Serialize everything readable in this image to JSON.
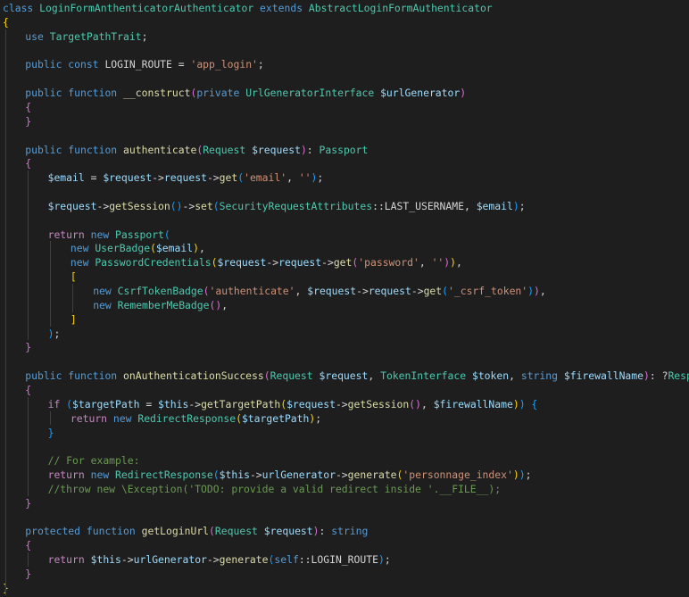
{
  "code": {
    "colors": {
      "background": "#1e1e1e",
      "keyword": "#569cd6",
      "control": "#c586c0",
      "function": "#dcdcaa",
      "class": "#4ec9b0",
      "variable": "#9cdcfe",
      "string": "#ce9178",
      "comment": "#6a9955",
      "plain": "#d4d4d4",
      "bracket_1": "#ffd700",
      "bracket_2": "#da70d6",
      "bracket_3": "#179fff"
    },
    "lines": [
      {
        "indent": 0,
        "tokens": [
          [
            "kw",
            "class "
          ],
          [
            "cls",
            "LoginFormAnthenticatorAuthenticator"
          ],
          [
            "pl",
            " "
          ],
          [
            "kw",
            "extends "
          ],
          [
            "cls",
            "AbstractLoginFormAuthenticator"
          ]
        ]
      },
      {
        "indent": 0,
        "tokens": [
          [
            "b1",
            "{"
          ]
        ]
      },
      {
        "indent": 1,
        "tokens": [
          [
            "kw",
            "use "
          ],
          [
            "cls",
            "TargetPathTrait"
          ],
          [
            "pl",
            ";"
          ]
        ]
      },
      {
        "indent": 0,
        "tokens": []
      },
      {
        "indent": 1,
        "tokens": [
          [
            "kw",
            "public const "
          ],
          [
            "pl",
            "LOGIN_ROUTE = "
          ],
          [
            "str",
            "'app_login'"
          ],
          [
            "pl",
            ";"
          ]
        ]
      },
      {
        "indent": 0,
        "tokens": []
      },
      {
        "indent": 1,
        "tokens": [
          [
            "kw",
            "public function "
          ],
          [
            "fn",
            "__construct"
          ],
          [
            "b2",
            "("
          ],
          [
            "kw",
            "private "
          ],
          [
            "cls",
            "UrlGeneratorInterface "
          ],
          [
            "var",
            "$urlGenerator"
          ],
          [
            "b2",
            ")"
          ]
        ]
      },
      {
        "indent": 1,
        "tokens": [
          [
            "b2",
            "{"
          ]
        ]
      },
      {
        "indent": 1,
        "tokens": [
          [
            "b2",
            "}"
          ]
        ]
      },
      {
        "indent": 0,
        "tokens": []
      },
      {
        "indent": 1,
        "tokens": [
          [
            "kw",
            "public function "
          ],
          [
            "fn",
            "authenticate"
          ],
          [
            "b2",
            "("
          ],
          [
            "cls",
            "Request "
          ],
          [
            "var",
            "$request"
          ],
          [
            "b2",
            ")"
          ],
          [
            "pl",
            ": "
          ],
          [
            "cls",
            "Passport"
          ]
        ]
      },
      {
        "indent": 1,
        "tokens": [
          [
            "b2",
            "{"
          ]
        ]
      },
      {
        "indent": 2,
        "tokens": [
          [
            "var",
            "$email"
          ],
          [
            "pl",
            " = "
          ],
          [
            "var",
            "$request"
          ],
          [
            "pl",
            "->"
          ],
          [
            "var",
            "request"
          ],
          [
            "pl",
            "->"
          ],
          [
            "fn",
            "get"
          ],
          [
            "b3",
            "("
          ],
          [
            "str",
            "'email'"
          ],
          [
            "pl",
            ", "
          ],
          [
            "str",
            "''"
          ],
          [
            "b3",
            ")"
          ],
          [
            "pl",
            ";"
          ]
        ]
      },
      {
        "indent": 0,
        "tokens": []
      },
      {
        "indent": 2,
        "tokens": [
          [
            "var",
            "$request"
          ],
          [
            "pl",
            "->"
          ],
          [
            "fn",
            "getSession"
          ],
          [
            "b3",
            "()"
          ],
          [
            "pl",
            "->"
          ],
          [
            "fn",
            "set"
          ],
          [
            "b3",
            "("
          ],
          [
            "cls",
            "SecurityRequestAttributes"
          ],
          [
            "pl",
            "::LAST_USERNAME, "
          ],
          [
            "var",
            "$email"
          ],
          [
            "b3",
            ")"
          ],
          [
            "pl",
            ";"
          ]
        ]
      },
      {
        "indent": 0,
        "tokens": []
      },
      {
        "indent": 2,
        "tokens": [
          [
            "ctrl",
            "return "
          ],
          [
            "kw",
            "new "
          ],
          [
            "cls",
            "Passport"
          ],
          [
            "b3",
            "("
          ]
        ]
      },
      {
        "indent": 3,
        "tokens": [
          [
            "kw",
            "new "
          ],
          [
            "cls",
            "UserBadge"
          ],
          [
            "b1",
            "("
          ],
          [
            "var",
            "$email"
          ],
          [
            "b1",
            ")"
          ],
          [
            "pl",
            ","
          ]
        ]
      },
      {
        "indent": 3,
        "tokens": [
          [
            "kw",
            "new "
          ],
          [
            "cls",
            "PasswordCredentials"
          ],
          [
            "b1",
            "("
          ],
          [
            "var",
            "$request"
          ],
          [
            "pl",
            "->"
          ],
          [
            "var",
            "request"
          ],
          [
            "pl",
            "->"
          ],
          [
            "fn",
            "get"
          ],
          [
            "b2",
            "("
          ],
          [
            "str",
            "'password'"
          ],
          [
            "pl",
            ", "
          ],
          [
            "str",
            "''"
          ],
          [
            "b2",
            ")"
          ],
          [
            "b1",
            ")"
          ],
          [
            "pl",
            ","
          ]
        ]
      },
      {
        "indent": 3,
        "tokens": [
          [
            "b1",
            "["
          ]
        ]
      },
      {
        "indent": 4,
        "tokens": [
          [
            "kw",
            "new "
          ],
          [
            "cls",
            "CsrfTokenBadge"
          ],
          [
            "b2",
            "("
          ],
          [
            "str",
            "'authenticate'"
          ],
          [
            "pl",
            ", "
          ],
          [
            "var",
            "$request"
          ],
          [
            "pl",
            "->"
          ],
          [
            "var",
            "request"
          ],
          [
            "pl",
            "->"
          ],
          [
            "fn",
            "get"
          ],
          [
            "b3",
            "("
          ],
          [
            "str",
            "'_csrf_token'"
          ],
          [
            "b3",
            ")"
          ],
          [
            "b2",
            ")"
          ],
          [
            "pl",
            ","
          ]
        ]
      },
      {
        "indent": 4,
        "tokens": [
          [
            "kw",
            "new "
          ],
          [
            "cls",
            "RememberMeBadge"
          ],
          [
            "b2",
            "()"
          ],
          [
            "pl",
            ","
          ]
        ]
      },
      {
        "indent": 3,
        "tokens": [
          [
            "b1",
            "]"
          ]
        ]
      },
      {
        "indent": 2,
        "tokens": [
          [
            "b3",
            ")"
          ],
          [
            "pl",
            ";"
          ]
        ]
      },
      {
        "indent": 1,
        "tokens": [
          [
            "b2",
            "}"
          ]
        ]
      },
      {
        "indent": 0,
        "tokens": []
      },
      {
        "indent": 1,
        "tokens": [
          [
            "kw",
            "public function "
          ],
          [
            "fn",
            "onAuthenticationSuccess"
          ],
          [
            "b2",
            "("
          ],
          [
            "cls",
            "Request "
          ],
          [
            "var",
            "$request"
          ],
          [
            "pl",
            ", "
          ],
          [
            "cls",
            "TokenInterface "
          ],
          [
            "var",
            "$token"
          ],
          [
            "pl",
            ", "
          ],
          [
            "kw",
            "string "
          ],
          [
            "var",
            "$firewallName"
          ],
          [
            "b2",
            ")"
          ],
          [
            "pl",
            ": ?"
          ],
          [
            "cls",
            "Response"
          ]
        ]
      },
      {
        "indent": 1,
        "tokens": [
          [
            "b2",
            "{"
          ]
        ]
      },
      {
        "indent": 2,
        "tokens": [
          [
            "ctrl",
            "if "
          ],
          [
            "b3",
            "("
          ],
          [
            "var",
            "$targetPath"
          ],
          [
            "pl",
            " = "
          ],
          [
            "var",
            "$this"
          ],
          [
            "pl",
            "->"
          ],
          [
            "fn",
            "getTargetPath"
          ],
          [
            "b1",
            "("
          ],
          [
            "var",
            "$request"
          ],
          [
            "pl",
            "->"
          ],
          [
            "fn",
            "getSession"
          ],
          [
            "b2",
            "()"
          ],
          [
            "pl",
            ", "
          ],
          [
            "var",
            "$firewallName"
          ],
          [
            "b1",
            ")"
          ],
          [
            "b3",
            ") {"
          ]
        ]
      },
      {
        "indent": 3,
        "tokens": [
          [
            "ctrl",
            "return "
          ],
          [
            "kw",
            "new "
          ],
          [
            "cls",
            "RedirectResponse"
          ],
          [
            "b1",
            "("
          ],
          [
            "var",
            "$targetPath"
          ],
          [
            "b1",
            ")"
          ],
          [
            "pl",
            ";"
          ]
        ]
      },
      {
        "indent": 2,
        "tokens": [
          [
            "b3",
            "}"
          ]
        ]
      },
      {
        "indent": 0,
        "tokens": []
      },
      {
        "indent": 2,
        "tokens": [
          [
            "cmt",
            "// For example:"
          ]
        ]
      },
      {
        "indent": 2,
        "tokens": [
          [
            "ctrl",
            "return "
          ],
          [
            "kw",
            "new "
          ],
          [
            "cls",
            "RedirectResponse"
          ],
          [
            "b3",
            "("
          ],
          [
            "var",
            "$this"
          ],
          [
            "pl",
            "->"
          ],
          [
            "var",
            "urlGenerator"
          ],
          [
            "pl",
            "->"
          ],
          [
            "fn",
            "generate"
          ],
          [
            "b1",
            "("
          ],
          [
            "str",
            "'personnage_index'"
          ],
          [
            "b1",
            ")"
          ],
          [
            "b3",
            ")"
          ],
          [
            "pl",
            ";"
          ]
        ]
      },
      {
        "indent": 2,
        "tokens": [
          [
            "cmt",
            "//throw new \\Exception('TODO: provide a valid redirect inside '.__FILE__);"
          ]
        ]
      },
      {
        "indent": 1,
        "tokens": [
          [
            "b2",
            "}"
          ]
        ]
      },
      {
        "indent": 0,
        "tokens": []
      },
      {
        "indent": 1,
        "tokens": [
          [
            "kw",
            "protected function "
          ],
          [
            "fn",
            "getLoginUrl"
          ],
          [
            "b2",
            "("
          ],
          [
            "cls",
            "Request "
          ],
          [
            "var",
            "$request"
          ],
          [
            "b2",
            ")"
          ],
          [
            "pl",
            ": "
          ],
          [
            "kw",
            "string"
          ]
        ]
      },
      {
        "indent": 1,
        "tokens": [
          [
            "b2",
            "{"
          ]
        ]
      },
      {
        "indent": 2,
        "tokens": [
          [
            "ctrl",
            "return "
          ],
          [
            "var",
            "$this"
          ],
          [
            "pl",
            "->"
          ],
          [
            "var",
            "urlGenerator"
          ],
          [
            "pl",
            "->"
          ],
          [
            "fn",
            "generate"
          ],
          [
            "b3",
            "("
          ],
          [
            "kw",
            "self"
          ],
          [
            "pl",
            "::LOGIN_ROUTE"
          ],
          [
            "b3",
            ")"
          ],
          [
            "pl",
            ";"
          ]
        ]
      },
      {
        "indent": 1,
        "tokens": [
          [
            "b2",
            "}"
          ]
        ]
      },
      {
        "indent": 0,
        "tokens": [
          [
            "b1",
            "}"
          ]
        ]
      }
    ]
  }
}
